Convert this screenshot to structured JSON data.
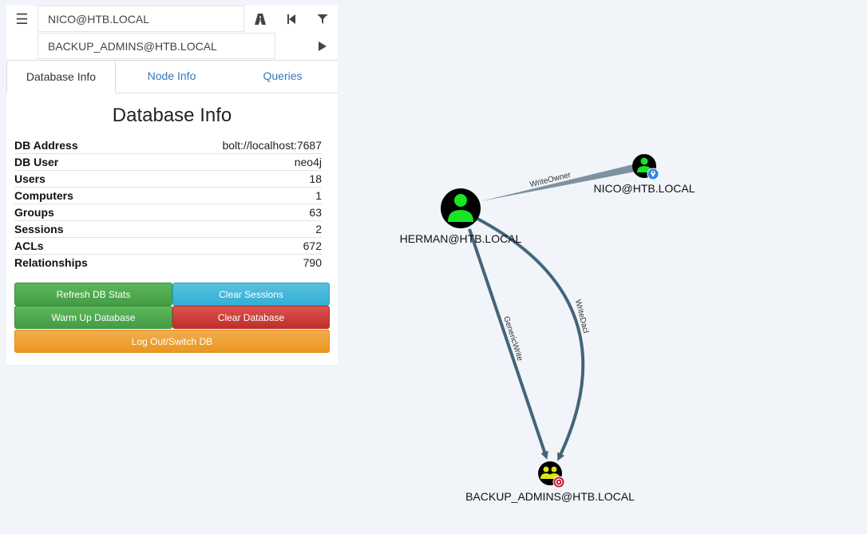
{
  "search": {
    "start_node": "NICO@HTB.LOCAL",
    "target_node": "BACKUP_ADMINS@HTB.LOCAL"
  },
  "tabs": [
    {
      "label": "Database Info",
      "active": true
    },
    {
      "label": "Node Info",
      "active": false
    },
    {
      "label": "Queries",
      "active": false
    }
  ],
  "db_info": {
    "title": "Database Info",
    "stats": [
      {
        "label": "DB Address",
        "value": "bolt://localhost:7687"
      },
      {
        "label": "DB User",
        "value": "neo4j"
      },
      {
        "label": "Users",
        "value": "18"
      },
      {
        "label": "Computers",
        "value": "1"
      },
      {
        "label": "Groups",
        "value": "63"
      },
      {
        "label": "Sessions",
        "value": "2"
      },
      {
        "label": "ACLs",
        "value": "672"
      },
      {
        "label": "Relationships",
        "value": "790"
      }
    ]
  },
  "buttons": {
    "refresh": "Refresh DB Stats",
    "clear_sessions": "Clear Sessions",
    "warm_up": "Warm Up Database",
    "clear_db": "Clear Database",
    "logout": "Log Out/Switch DB"
  },
  "graph": {
    "nodes": {
      "herman": "HERMAN@HTB.LOCAL",
      "nico": "NICO@HTB.LOCAL",
      "backup": "BACKUP_ADMINS@HTB.LOCAL"
    },
    "edges": {
      "write_owner": "WriteOwner",
      "generic_write": "GenericWrite",
      "write_dacl": "WriteDacl"
    }
  },
  "colors": {
    "user_node": "#17e625",
    "group_node": "#dbe617",
    "edge": "#446579",
    "start_marker": "#2a86e6",
    "target_marker": "#c8102e"
  }
}
